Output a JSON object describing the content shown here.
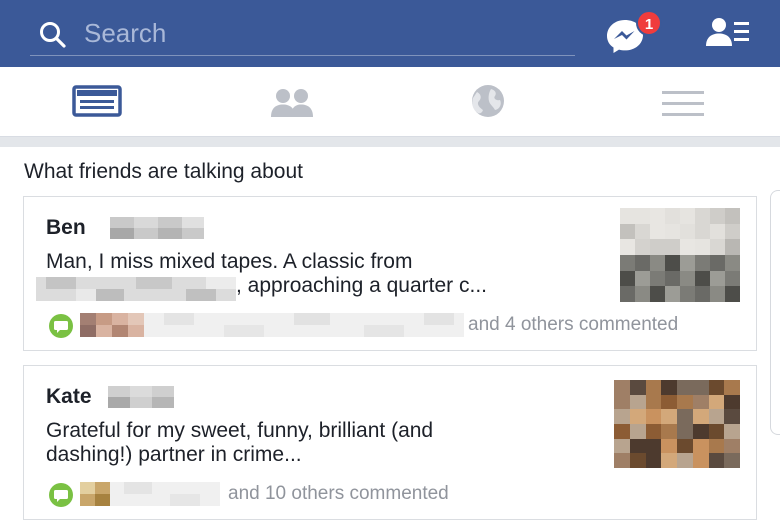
{
  "colors": {
    "brand": "#3b5998",
    "badge": "#f03c3c",
    "comment_green": "#7ac143"
  },
  "header": {
    "search_placeholder": "Search",
    "messenger_badge": "1",
    "icons": [
      "search-icon",
      "messenger-icon",
      "friend-requests-icon"
    ]
  },
  "nav": {
    "tabs": [
      {
        "name": "news-feed",
        "icon": "news-feed-icon",
        "active": true
      },
      {
        "name": "friends",
        "icon": "friends-icon",
        "active": false
      },
      {
        "name": "notifications",
        "icon": "globe-icon",
        "active": false
      },
      {
        "name": "menu",
        "icon": "hamburger-menu-icon",
        "active": false
      }
    ]
  },
  "feed": {
    "section_title": "What friends are talking about",
    "stories": [
      {
        "name": "Ben",
        "snippet_line1": "Man, I miss mixed tapes. A classic from",
        "snippet_line2": ", approaching a quarter c...",
        "commenters_text": "and 4 others commented"
      },
      {
        "name": "Kate",
        "snippet_line1": "Grateful for my sweet, funny, brilliant (and",
        "snippet_line2": "dashing!) partner in crime...",
        "commenters_text": "and 10 others commented"
      }
    ]
  }
}
